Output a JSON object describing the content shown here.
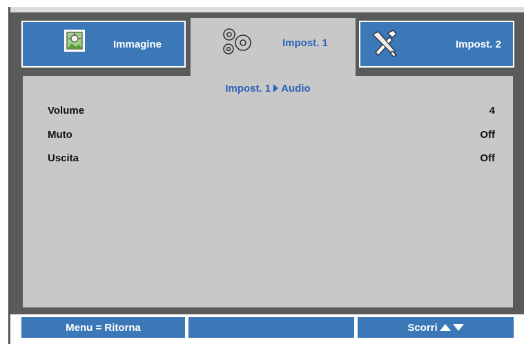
{
  "tabs": [
    {
      "label": "Immagine",
      "icon": "image-icon"
    },
    {
      "label": "Impost. 1",
      "icon": "gears-icon"
    },
    {
      "label": "Impost. 2",
      "icon": "tools-icon"
    }
  ],
  "breadcrumb": {
    "parent": "Impost. 1",
    "child": "Audio"
  },
  "settings": [
    {
      "label": "Volume",
      "value": "4"
    },
    {
      "label": "Muto",
      "value": "Off"
    },
    {
      "label": "Uscita",
      "value": "Off"
    }
  ],
  "footer": {
    "left": "Menu = Ritorna",
    "middle": "",
    "right": "Scorri"
  },
  "colors": {
    "accent": "#3c78b8",
    "active_text": "#2b63b5",
    "panel": "#c8c8c8",
    "frame": "#5a5a5a"
  }
}
